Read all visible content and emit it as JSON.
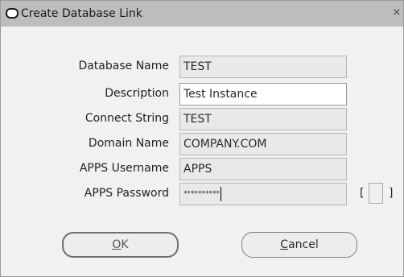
{
  "window": {
    "title": "Create Database Link",
    "close_glyph": "×"
  },
  "form": {
    "fields": [
      {
        "label": "Database Name",
        "value": "TEST"
      },
      {
        "label": "Description",
        "value": "Test Instance"
      },
      {
        "label": "Connect String",
        "value": "TEST"
      },
      {
        "label": "Domain Name",
        "value": "COMPANY.COM"
      },
      {
        "label": "APPS Username",
        "value": "APPS"
      },
      {
        "label": "APPS Password",
        "value": "**********"
      }
    ],
    "checkbox": {
      "left_bracket": "[",
      "right_bracket": "]",
      "checked": false
    }
  },
  "buttons": {
    "ok": {
      "mnemonic": "O",
      "rest": "K"
    },
    "cancel": {
      "mnemonic": "C",
      "rest": "ancel"
    }
  },
  "icons": {
    "window_icon": "window-oval-icon",
    "close": "close-icon"
  },
  "colors": {
    "titlebar": "#bdbdbd",
    "background": "#f1f1f1",
    "readonly_field": "#e9e9e9",
    "editable_field": "#ffffff"
  }
}
